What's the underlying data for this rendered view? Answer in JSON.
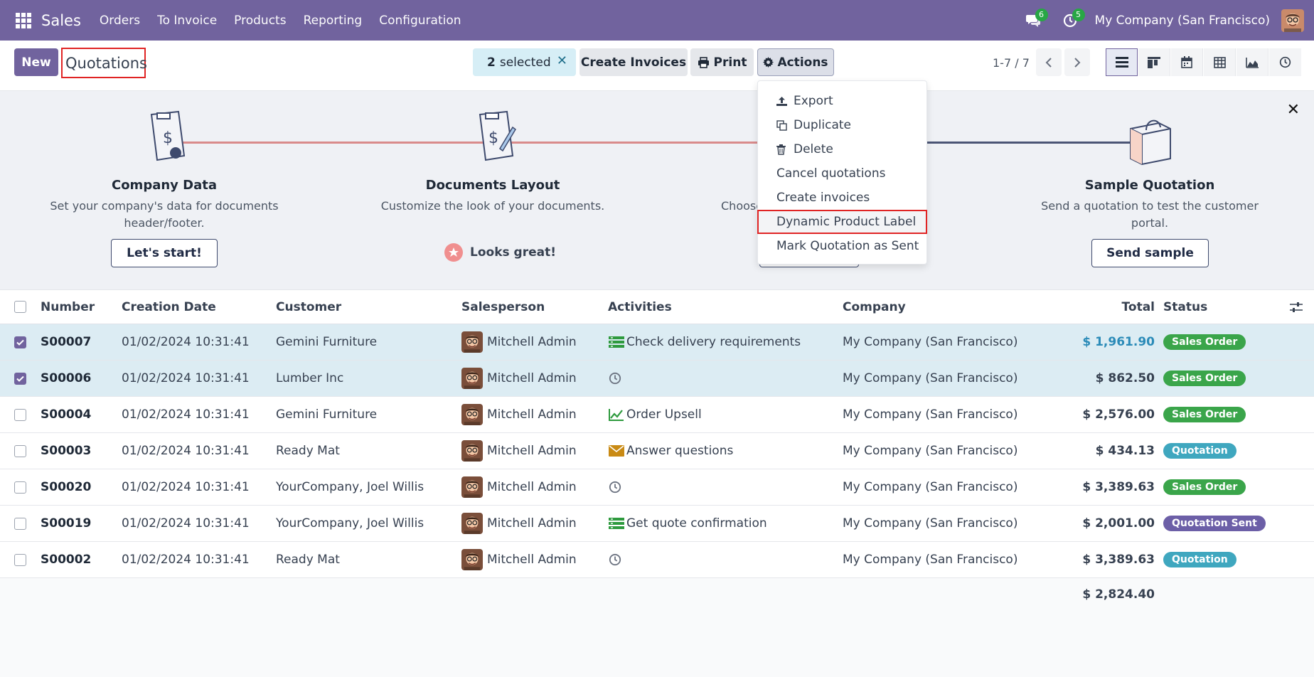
{
  "navbar": {
    "app_name": "Sales",
    "menu": [
      "Orders",
      "To Invoice",
      "Products",
      "Reporting",
      "Configuration"
    ],
    "messages_count": "6",
    "activities_count": "5",
    "company": "My Company (San Francisco)"
  },
  "control": {
    "new_label": "New",
    "title": "Quotations",
    "selected_count": "2",
    "selected_label": "selected",
    "create_invoices_label": "Create Invoices",
    "print_label": "Print",
    "actions_label": "Actions",
    "pager": "1-7 / 7"
  },
  "actions_menu": [
    {
      "label": "Export",
      "icon": "upload-icon"
    },
    {
      "label": "Duplicate",
      "icon": "copy-icon"
    },
    {
      "label": "Delete",
      "icon": "trash-icon"
    },
    {
      "label": "Cancel quotations",
      "icon": ""
    },
    {
      "label": "Create invoices",
      "icon": ""
    },
    {
      "label": "Dynamic Product Label",
      "icon": ""
    },
    {
      "label": "Mark Quotation as Sent",
      "icon": ""
    }
  ],
  "banner": {
    "steps": [
      {
        "title": "Company Data",
        "desc": "Set your company's data for documents header/footer.",
        "button": "Let's start!"
      },
      {
        "title": "Documents Layout",
        "desc": "Customize the look of your documents.",
        "done_label": "Looks great!"
      },
      {
        "title": "",
        "desc": "Choose",
        "button": ""
      },
      {
        "title": "Sample Quotation",
        "desc": "Send a quotation to test the customer portal.",
        "button": "Send sample"
      }
    ]
  },
  "table": {
    "headers": {
      "number": "Number",
      "date": "Creation Date",
      "customer": "Customer",
      "salesperson": "Salesperson",
      "activities": "Activities",
      "company": "Company",
      "total": "Total",
      "status": "Status"
    },
    "rows": [
      {
        "selected": true,
        "number": "S00007",
        "date": "01/02/2024 10:31:41",
        "customer": "Gemini Furniture",
        "salesperson": "Mitchell Admin",
        "activity_icon": "list-icon",
        "activity": "Check delivery requirements",
        "company": "My Company (San Francisco)",
        "total": "$ 1,961.90",
        "status": "Sales Order",
        "status_color": "#3aa54a"
      },
      {
        "selected": true,
        "number": "S00006",
        "date": "01/02/2024 10:31:41",
        "customer": "Lumber Inc",
        "salesperson": "Mitchell Admin",
        "activity_icon": "clock-icon",
        "activity": "",
        "company": "My Company (San Francisco)",
        "total": "$ 862.50",
        "status": "Sales Order",
        "status_color": "#3aa54a"
      },
      {
        "selected": false,
        "number": "S00004",
        "date": "01/02/2024 10:31:41",
        "customer": "Gemini Furniture",
        "salesperson": "Mitchell Admin",
        "activity_icon": "chart-icon",
        "activity": "Order Upsell",
        "company": "My Company (San Francisco)",
        "total": "$ 2,576.00",
        "status": "Sales Order",
        "status_color": "#3aa54a"
      },
      {
        "selected": false,
        "number": "S00003",
        "date": "01/02/2024 10:31:41",
        "customer": "Ready Mat",
        "salesperson": "Mitchell Admin",
        "activity_icon": "envelope-icon",
        "activity": "Answer questions",
        "company": "My Company (San Francisco)",
        "total": "$ 434.13",
        "status": "Quotation",
        "status_color": "#3fa7bf"
      },
      {
        "selected": false,
        "number": "S00020",
        "date": "01/02/2024 10:31:41",
        "customer": "YourCompany, Joel Willis",
        "salesperson": "Mitchell Admin",
        "activity_icon": "clock-icon",
        "activity": "",
        "company": "My Company (San Francisco)",
        "total": "$ 3,389.63",
        "status": "Sales Order",
        "status_color": "#3aa54a"
      },
      {
        "selected": false,
        "number": "S00019",
        "date": "01/02/2024 10:31:41",
        "customer": "YourCompany, Joel Willis",
        "salesperson": "Mitchell Admin",
        "activity_icon": "list-icon",
        "activity": "Get quote confirmation",
        "company": "My Company (San Francisco)",
        "total": "$ 2,001.00",
        "status": "Quotation Sent",
        "status_color": "#6c5fa7"
      },
      {
        "selected": false,
        "number": "S00002",
        "date": "01/02/2024 10:31:41",
        "customer": "Ready Mat",
        "salesperson": "Mitchell Admin",
        "activity_icon": "clock-icon",
        "activity": "",
        "company": "My Company (San Francisco)",
        "total": "$ 3,389.63",
        "status": "Quotation",
        "status_color": "#3fa7bf"
      }
    ],
    "sum_total": "$ 2,824.40"
  }
}
